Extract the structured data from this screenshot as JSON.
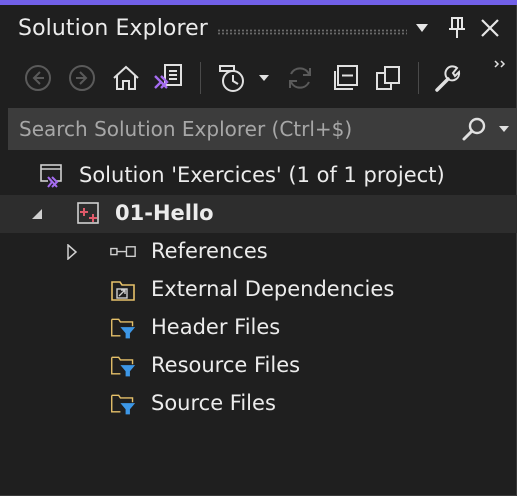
{
  "panel": {
    "title": "Solution Explorer",
    "accent_color": "#7160e8"
  },
  "toolbar": {
    "icons": [
      "back-icon",
      "forward-icon",
      "home-icon",
      "switch-views-icon",
      "pending-changes-filter-icon",
      "dropdown-icon",
      "sync-icon",
      "collapse-all-icon",
      "show-all-files-icon",
      "properties-icon",
      "overflow-icon"
    ]
  },
  "search": {
    "placeholder": "Search Solution Explorer (Ctrl+$)"
  },
  "tree": {
    "solution": {
      "label": "Solution 'Exercices' (1 of 1 project)"
    },
    "project": {
      "label": "01-Hello",
      "expanded": true,
      "selected": true
    },
    "items": [
      {
        "label": "References",
        "icon": "references-icon",
        "expandable": true
      },
      {
        "label": "External Dependencies",
        "icon": "external-dependencies-icon",
        "expandable": false
      },
      {
        "label": "Header Files",
        "icon": "filter-folder-icon",
        "expandable": false
      },
      {
        "label": "Resource Files",
        "icon": "filter-folder-icon",
        "expandable": false
      },
      {
        "label": "Source Files",
        "icon": "filter-folder-icon",
        "expandable": false
      }
    ]
  }
}
